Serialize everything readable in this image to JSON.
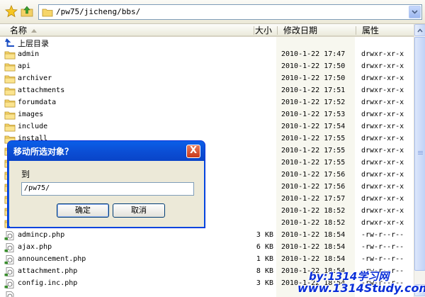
{
  "toolbar": {
    "address": "/pw75/jicheng/bbs/"
  },
  "header": {
    "name": "名称",
    "size": "大小",
    "modified": "修改日期",
    "attributes": "属性"
  },
  "parent_dir_label": "上层目录",
  "rows": [
    {
      "name": "admin",
      "type": "folder",
      "size": "",
      "date": "2010-1-22 17:47",
      "perm": "drwxr-xr-x"
    },
    {
      "name": "api",
      "type": "folder",
      "size": "",
      "date": "2010-1-22 17:50",
      "perm": "drwxr-xr-x"
    },
    {
      "name": "archiver",
      "type": "folder",
      "size": "",
      "date": "2010-1-22 17:50",
      "perm": "drwxr-xr-x"
    },
    {
      "name": "attachments",
      "type": "folder",
      "size": "",
      "date": "2010-1-22 17:51",
      "perm": "drwxr-xr-x"
    },
    {
      "name": "forumdata",
      "type": "folder",
      "size": "",
      "date": "2010-1-22 17:52",
      "perm": "drwxr-xr-x"
    },
    {
      "name": "images",
      "type": "folder",
      "size": "",
      "date": "2010-1-22 17:53",
      "perm": "drwxr-xr-x"
    },
    {
      "name": "include",
      "type": "folder",
      "size": "",
      "date": "2010-1-22 17:54",
      "perm": "drwxr-xr-x"
    },
    {
      "name": "install",
      "type": "folder",
      "size": "",
      "date": "2010-1-22 17:55",
      "perm": "drwxr-xr-x"
    },
    {
      "name": "",
      "type": "folder",
      "size": "",
      "date": "2010-1-22 17:55",
      "perm": "drwxr-xr-x"
    },
    {
      "name": "",
      "type": "folder",
      "size": "",
      "date": "2010-1-22 17:55",
      "perm": "drwxr-xr-x"
    },
    {
      "name": "",
      "type": "folder",
      "size": "",
      "date": "2010-1-22 17:56",
      "perm": "drwxr-xr-x"
    },
    {
      "name": "",
      "type": "folder",
      "size": "",
      "date": "2010-1-22 17:56",
      "perm": "drwxr-xr-x"
    },
    {
      "name": "",
      "type": "folder",
      "size": "",
      "date": "2010-1-22 17:57",
      "perm": "drwxr-xr-x"
    },
    {
      "name": "",
      "type": "folder",
      "size": "",
      "date": "2010-1-22 18:52",
      "perm": "drwxr-xr-x"
    },
    {
      "name": "",
      "type": "folder",
      "size": "",
      "date": "2010-1-22 18:52",
      "perm": "drwxr-xr-x"
    },
    {
      "name": "admincp.php",
      "type": "file",
      "size": "3 KB",
      "date": "2010-1-22 18:54",
      "perm": "-rw-r--r--"
    },
    {
      "name": "ajax.php",
      "type": "file",
      "size": "6 KB",
      "date": "2010-1-22 18:54",
      "perm": "-rw-r--r--"
    },
    {
      "name": "announcement.php",
      "type": "file",
      "size": "1 KB",
      "date": "2010-1-22 18:54",
      "perm": "-rw-r--r--"
    },
    {
      "name": "attachment.php",
      "type": "file",
      "size": "8 KB",
      "date": "2010-1-22 18:54",
      "perm": "-rw-r--r--"
    },
    {
      "name": "config.inc.php",
      "type": "file",
      "size": "3 KB",
      "date": "2010-1-22 18:54",
      "perm": "-rw-r--r--"
    },
    {
      "name": "",
      "type": "file",
      "size": "",
      "date": "",
      "perm": ""
    }
  ],
  "dialog": {
    "title": "移动所选对象？",
    "close_label": "X",
    "to_label": "到",
    "target_value": "/pw75/",
    "ok_label": "确定",
    "cancel_label": "取消"
  },
  "watermark": {
    "line1": "by:1314学习网",
    "line2": "www.1314Study.com"
  },
  "colors": {
    "titlebar": "#0a4fd6",
    "folder": "#f6d56a",
    "header_bg": "#ebeadb"
  }
}
